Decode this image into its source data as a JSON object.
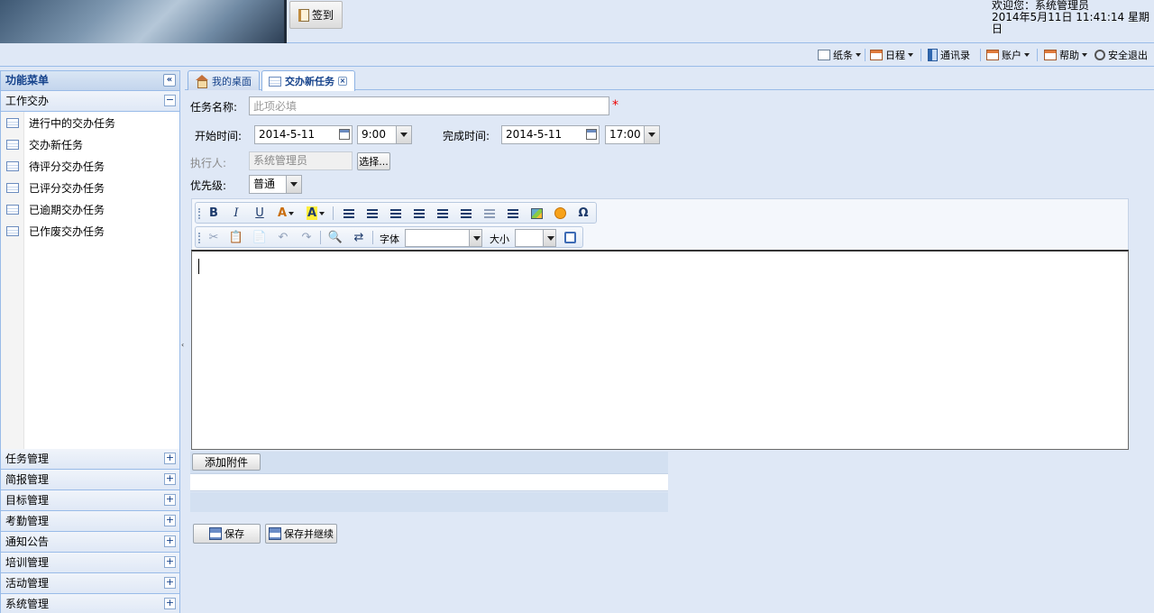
{
  "header": {
    "signin_label": "签到",
    "welcome_line1": "欢迎您：系统管理员",
    "welcome_line2": "2014年5月11日 11:41:14 星期日"
  },
  "toolbar": {
    "items": [
      {
        "label": "纸条",
        "icon": "note-icon",
        "dropdown": true
      },
      {
        "label": "日程",
        "icon": "calendar-icon",
        "dropdown": true
      },
      {
        "label": "通讯录",
        "icon": "addressbook-icon",
        "dropdown": false
      },
      {
        "label": "账户",
        "icon": "account-icon",
        "dropdown": true
      },
      {
        "label": "帮助",
        "icon": "help-icon",
        "dropdown": true
      },
      {
        "label": "安全退出",
        "icon": "power-icon",
        "dropdown": false
      }
    ]
  },
  "sidebar": {
    "title": "功能菜单",
    "collapse_symbol": "«",
    "expanded_section": {
      "label": "工作交办",
      "toggle": "−",
      "items": [
        "进行中的交办任务",
        "交办新任务",
        "待评分交办任务",
        "已评分交办任务",
        "已逾期交办任务",
        "已作废交办任务"
      ]
    },
    "sections": [
      {
        "label": "任务管理",
        "toggle": "+"
      },
      {
        "label": "简报管理",
        "toggle": "+"
      },
      {
        "label": "目标管理",
        "toggle": "+"
      },
      {
        "label": "考勤管理",
        "toggle": "+"
      },
      {
        "label": "通知公告",
        "toggle": "+"
      },
      {
        "label": "培训管理",
        "toggle": "+"
      },
      {
        "label": "活动管理",
        "toggle": "+"
      },
      {
        "label": "系统管理",
        "toggle": "+"
      }
    ]
  },
  "tabs": [
    {
      "label": "我的桌面",
      "active": false
    },
    {
      "label": "交办新任务",
      "active": true,
      "close": "×"
    }
  ],
  "form": {
    "task_name_label": "任务名称:",
    "task_name_placeholder": "此项必填",
    "required_mark": "*",
    "start_label": "开始时间:",
    "start_date": "2014-5-11",
    "start_time": "9:00",
    "end_label": "完成时间:",
    "end_date": "2014-5-11",
    "end_time": "17:00",
    "executor_label": "执行人:",
    "executor_value": "系统管理员",
    "choose_label": "选择...",
    "priority_label": "优先级:",
    "priority_value": "普通"
  },
  "editor": {
    "bold": "B",
    "italic": "I",
    "underline": "U",
    "font_color": "A",
    "highlight": "A",
    "special_char": "Ω",
    "font_label": "字体",
    "size_label": "大小"
  },
  "attachments": {
    "add_label": "添加附件"
  },
  "actions": {
    "save_label": "保存",
    "save_continue_label": "保存并继续"
  }
}
